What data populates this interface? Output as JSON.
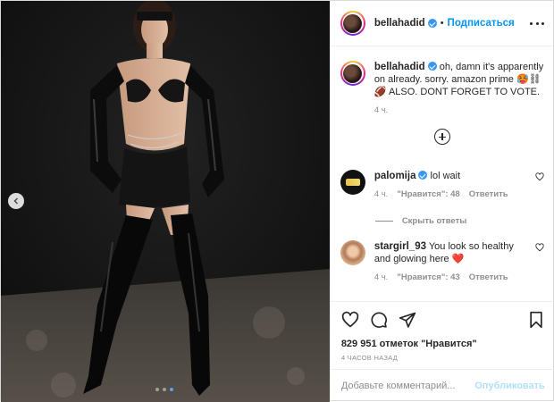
{
  "post": {
    "author": "bellahadid",
    "follow_label": "Подписаться",
    "separator": "•"
  },
  "caption": {
    "username": "bellahadid",
    "text": "oh, damn it's apparently on already. sorry. amazon prime 🥵⛓ 🏈 ALSO. DONT FORGET TO VOTE.",
    "time": "4 ч."
  },
  "comments": [
    {
      "username": "palomija",
      "verified": true,
      "text": "lol wait",
      "time": "4 ч.",
      "likes": "\"Нравится\": 48",
      "reply_label": "Ответить"
    },
    {
      "username": "stargirl_93",
      "verified": false,
      "text": "You look so healthy and glowing here ❤️",
      "time": "4 ч.",
      "likes": "\"Нравится\": 43",
      "reply_label": "Ответить"
    }
  ],
  "hide_replies_label": "Скрыть ответы",
  "likes_count": "829 951 отметок \"Нравится\"",
  "posted_ago": "4 часов назад",
  "comment_input": {
    "placeholder": "Добавьте комментарий...",
    "publish_label": "Опубликовать"
  },
  "carousel": {
    "slides": 3,
    "active_index": 2
  },
  "colors": {
    "link_blue": "#0095f6",
    "publish_disabled": "#b2dffc",
    "verified": "#3897f0"
  },
  "icons": [
    "chevron-left-icon",
    "more-icon",
    "load-more-comments-icon",
    "heart-icon",
    "comment-icon",
    "share-icon",
    "bookmark-icon",
    "verified-badge-icon"
  ]
}
